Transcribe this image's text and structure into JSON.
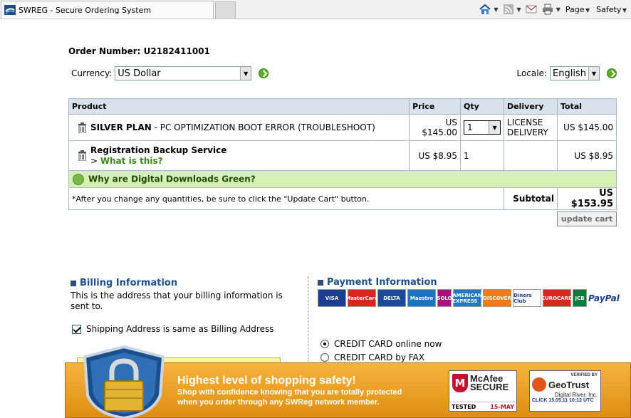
{
  "browser": {
    "tab_title": "SWREG - Secure Ordering System",
    "page_menu": "Page",
    "safety_menu": "Safety"
  },
  "order": {
    "number_label": "Order Number: U2182411001",
    "currency_label": "Currency:",
    "currency_value": "US Dollar",
    "locale_label": "Locale:",
    "locale_value": "English"
  },
  "cart": {
    "headers": [
      "Product",
      "Price",
      "Qty",
      "Delivery",
      "Total"
    ],
    "rows": [
      {
        "name": "SILVER PLAN",
        "desc": " - PC OPTIMIZATION BOOT ERROR (TROUBLESHOOT)",
        "price": "US $145.00",
        "qty": "1",
        "delivery_line1": "LICENSE",
        "delivery_line2": "DELIVERY",
        "total": "US $145.00"
      },
      {
        "name": "Registration Backup Service",
        "link_prefix": "> ",
        "link": "What is this?",
        "price": "US $8.95",
        "qty": "1",
        "total": "US $8.95"
      }
    ],
    "green_note": "Why are Digital Downloads Green?",
    "footer_note": "*After you change any quantities, be sure to click the \"Update Cart\" button.",
    "subtotal_label": "Subtotal",
    "subtotal_value": "US $153.95",
    "update_button": "update cart"
  },
  "billing": {
    "title": "Billing Information",
    "desc": "This is the address that your billing information is sent to.",
    "shipping_same": "Shipping Address is same as Billing Address",
    "shipping_checked": true
  },
  "payment": {
    "title": "Payment Information",
    "cards": [
      {
        "label": "VISA",
        "color": "#1a3d8f"
      },
      {
        "label": "MasterCard",
        "color": "#d8251d"
      },
      {
        "label": "DELTA",
        "color": "#1b4a9c"
      },
      {
        "label": "Maestro",
        "color": "#1b73c4"
      },
      {
        "label": "SOLO",
        "color": "#a8117d"
      },
      {
        "label": "AMERICAN EXPRESS",
        "color": "#2377c4"
      },
      {
        "label": "DISCOVER",
        "color": "#f27a14"
      },
      {
        "label": "Diners Club",
        "color": "#ffffff"
      },
      {
        "label": "EUROCARD",
        "color": "#d8251d"
      },
      {
        "label": "JCB",
        "color": "#0b7a3b"
      }
    ],
    "paypal": "PayPal",
    "options": [
      "CREDIT CARD online now",
      "CREDIT CARD by FAX"
    ]
  },
  "banner": {
    "title": "Highest level of shopping safety!",
    "line1": "Shop with confidence knowing that you are totally protected",
    "line2": "when you order through any SWReg network member.",
    "mcafee_name_1": "McAfee",
    "mcafee_name_2": "SECURE",
    "mcafee_tested": "TESTED",
    "mcafee_date": "15-MAY",
    "geotrust_verified": "VERIFIED BY",
    "geotrust_name": "GeoTrust",
    "geotrust_sub": "Digital River, Inc.",
    "geotrust_click": "CLICK 15.05.11 10:12 UTC"
  }
}
